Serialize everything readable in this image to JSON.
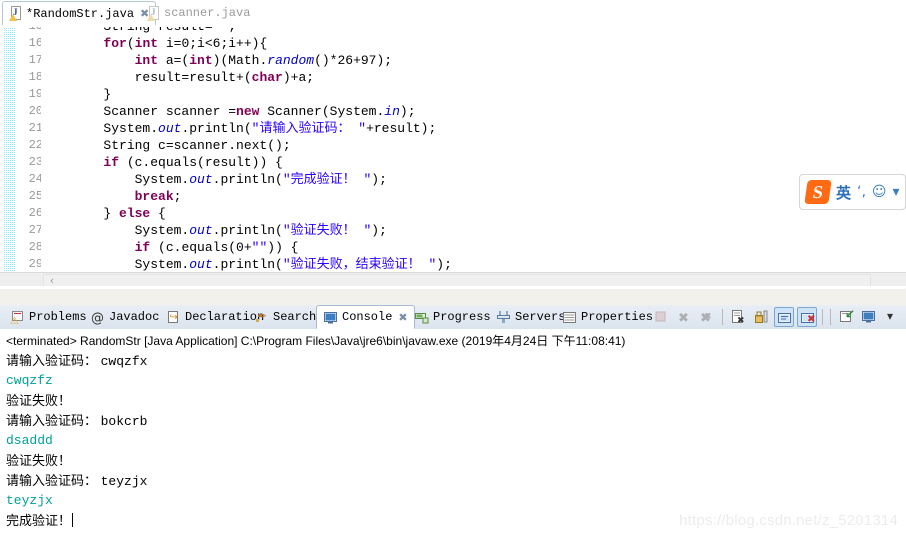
{
  "editor": {
    "tabs": [
      {
        "label": "*RandomStr.java",
        "active": true,
        "close": "✖",
        "icon": "java-file-warning-icon"
      },
      {
        "label": "scanner.java",
        "active": false,
        "close": "",
        "icon": "java-file-warning-icon"
      }
    ],
    "first_visible_line": 15,
    "lines": [
      {
        "num": "15",
        "clipped": true,
        "tokens": [
          {
            "t": "pln",
            "s": "        String result=\"\";"
          }
        ]
      },
      {
        "num": "16",
        "tokens": [
          {
            "t": "pln",
            "s": "        "
          },
          {
            "t": "kw",
            "s": "for"
          },
          {
            "t": "pln",
            "s": "("
          },
          {
            "t": "kw",
            "s": "int"
          },
          {
            "t": "pln",
            "s": " i=0;i<6;i++){"
          }
        ]
      },
      {
        "num": "17",
        "tokens": [
          {
            "t": "pln",
            "s": "            "
          },
          {
            "t": "kw",
            "s": "int"
          },
          {
            "t": "pln",
            "s": " a=("
          },
          {
            "t": "kw",
            "s": "int"
          },
          {
            "t": "pln",
            "s": ")(Math."
          },
          {
            "t": "fld",
            "s": "random"
          },
          {
            "t": "pln",
            "s": "()*26+97);"
          }
        ]
      },
      {
        "num": "18",
        "tokens": [
          {
            "t": "pln",
            "s": "            result=result+("
          },
          {
            "t": "kw",
            "s": "char"
          },
          {
            "t": "pln",
            "s": ")+a;"
          }
        ]
      },
      {
        "num": "19",
        "tokens": [
          {
            "t": "pln",
            "s": "        }"
          }
        ]
      },
      {
        "num": "20",
        "tokens": [
          {
            "t": "pln",
            "s": "        Scanner scanner ="
          },
          {
            "t": "kw",
            "s": "new"
          },
          {
            "t": "pln",
            "s": " Scanner(System."
          },
          {
            "t": "fld",
            "s": "in"
          },
          {
            "t": "pln",
            "s": ");"
          }
        ]
      },
      {
        "num": "21",
        "tokens": [
          {
            "t": "pln",
            "s": "        System."
          },
          {
            "t": "fld",
            "s": "out"
          },
          {
            "t": "pln",
            "s": ".println("
          },
          {
            "t": "str",
            "s": "\"请输入验证码： \""
          },
          {
            "t": "pln",
            "s": "+result);"
          }
        ]
      },
      {
        "num": "22",
        "tokens": [
          {
            "t": "pln",
            "s": "        String c=scanner.next();"
          }
        ]
      },
      {
        "num": "23",
        "tokens": [
          {
            "t": "pln",
            "s": "        "
          },
          {
            "t": "kw",
            "s": "if"
          },
          {
            "t": "pln",
            "s": " (c.equals(result)) {"
          }
        ]
      },
      {
        "num": "24",
        "tokens": [
          {
            "t": "pln",
            "s": "            System."
          },
          {
            "t": "fld",
            "s": "out"
          },
          {
            "t": "pln",
            "s": ".println("
          },
          {
            "t": "str",
            "s": "\"完成验证！ \""
          },
          {
            "t": "pln",
            "s": ");"
          }
        ]
      },
      {
        "num": "25",
        "tokens": [
          {
            "t": "pln",
            "s": "            "
          },
          {
            "t": "kw",
            "s": "break"
          },
          {
            "t": "pln",
            "s": ";"
          }
        ]
      },
      {
        "num": "26",
        "tokens": [
          {
            "t": "pln",
            "s": "        } "
          },
          {
            "t": "kw",
            "s": "else"
          },
          {
            "t": "pln",
            "s": " {"
          }
        ]
      },
      {
        "num": "27",
        "tokens": [
          {
            "t": "pln",
            "s": "            System."
          },
          {
            "t": "fld",
            "s": "out"
          },
          {
            "t": "pln",
            "s": ".println("
          },
          {
            "t": "str",
            "s": "\"验证失败！ \""
          },
          {
            "t": "pln",
            "s": ");"
          }
        ]
      },
      {
        "num": "28",
        "tokens": [
          {
            "t": "pln",
            "s": "            "
          },
          {
            "t": "kw",
            "s": "if"
          },
          {
            "t": "pln",
            "s": " (c.equals(0+"
          },
          {
            "t": "str",
            "s": "\"\""
          },
          {
            "t": "pln",
            "s": ")) {"
          }
        ]
      },
      {
        "num": "29",
        "clipped_bottom": true,
        "tokens": [
          {
            "t": "pln",
            "s": "            System."
          },
          {
            "t": "fld",
            "s": "out"
          },
          {
            "t": "pln",
            "s": ".println("
          },
          {
            "t": "str",
            "s": "\"验证失败，结束验证！ \""
          },
          {
            "t": "pln",
            "s": ");"
          }
        ]
      }
    ],
    "hscroll_left_arrow": "‹"
  },
  "console": {
    "tabs": [
      {
        "label": "Problems",
        "icon": "problems-icon",
        "active": false,
        "close": ""
      },
      {
        "label": "Javadoc",
        "icon": "javadoc-at-icon",
        "active": false,
        "close": ""
      },
      {
        "label": "Declaration",
        "icon": "declaration-icon",
        "active": false,
        "close": ""
      },
      {
        "label": "Search",
        "icon": "search-icon",
        "active": false,
        "close": ""
      },
      {
        "label": "Console",
        "icon": "console-icon",
        "active": true,
        "close": "✖"
      },
      {
        "label": "Progress",
        "icon": "progress-icon",
        "active": false,
        "close": ""
      },
      {
        "label": "Servers",
        "icon": "servers-icon",
        "active": false,
        "close": ""
      },
      {
        "label": "Properties",
        "icon": "properties-icon",
        "active": false,
        "close": ""
      }
    ],
    "toolbar": [
      {
        "name": "terminate-button",
        "enabled": false,
        "boxed": false
      },
      {
        "name": "remove-launch-button",
        "enabled": false,
        "boxed": false
      },
      {
        "name": "remove-all-terminated-button",
        "enabled": false,
        "boxed": false
      },
      {
        "name": "clear-console-button",
        "enabled": true,
        "boxed": false
      },
      {
        "name": "scroll-lock-button",
        "enabled": true,
        "boxed": false
      },
      {
        "name": "show-console-on-output-button",
        "enabled": true,
        "boxed": true
      },
      {
        "name": "show-console-on-error-button",
        "enabled": true,
        "boxed": true
      },
      {
        "name": "pin-console-button",
        "enabled": true,
        "boxed": false
      },
      {
        "name": "display-selected-console-button",
        "enabled": true,
        "boxed": false
      },
      {
        "name": "view-menu-button",
        "enabled": true,
        "boxed": false
      }
    ],
    "header_line": "<terminated> RandomStr [Java Application] C:\\Program Files\\Java\\jre6\\bin\\javaw.exe (2019年4月24日 下午11:08:41)",
    "output": [
      {
        "kind": "out",
        "prompt": "请输入验证码： ",
        "code": "cwqzfx"
      },
      {
        "kind": "input",
        "text": "cwqzfz"
      },
      {
        "kind": "msg",
        "text": "验证失败！"
      },
      {
        "kind": "out",
        "prompt": "请输入验证码： ",
        "code": "bokcrb"
      },
      {
        "kind": "input",
        "text": "dsaddd"
      },
      {
        "kind": "msg",
        "text": "验证失败！"
      },
      {
        "kind": "out",
        "prompt": "请输入验证码： ",
        "code": "teyzjx"
      },
      {
        "kind": "input",
        "text": "teyzjx"
      },
      {
        "kind": "msg",
        "text": "完成验证！",
        "caret": true
      }
    ]
  },
  "ime": {
    "logo": "S",
    "mode_label": "英",
    "punct_icon": "‘‚",
    "emoji_icon": "☺",
    "more_icon": "▾",
    "name": "sogou-input-method-toolbar"
  },
  "watermark": {
    "text": "https://blog.csdn.net/z_5201314"
  },
  "colors": {
    "keyword": "#7f0055",
    "string": "#2a00ff",
    "field": "#0000c0",
    "console_input": "#00a09a",
    "tab_border": "#a7bcd4",
    "marker_bar": "#3f94d2",
    "ime_orange": "#ff6a13"
  }
}
